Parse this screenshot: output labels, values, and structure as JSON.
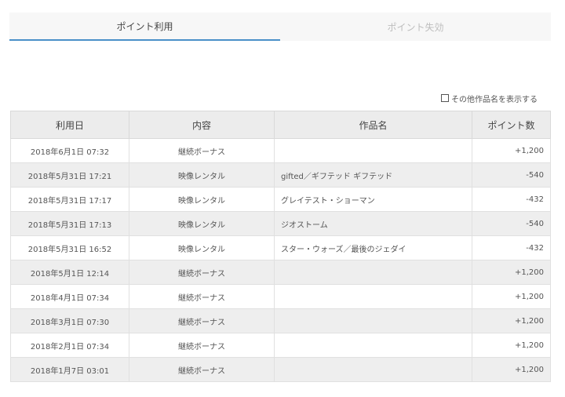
{
  "tabs": [
    {
      "label": "ポイント利用",
      "active": true
    },
    {
      "label": "ポイント失効",
      "active": false
    }
  ],
  "toggle": {
    "label": "その他作品名を表示する",
    "checked": false
  },
  "table": {
    "headers": [
      "利用日",
      "内容",
      "作品名",
      "ポイント数"
    ],
    "rows": [
      {
        "date": "2018年6月1日 07:32",
        "content": "継続ボーナス",
        "title": "",
        "points": "+1,200"
      },
      {
        "date": "2018年5月31日 17:21",
        "content": "映像レンタル",
        "title": "gifted／ギフテッド ギフテッド",
        "points": "-540"
      },
      {
        "date": "2018年5月31日 17:17",
        "content": "映像レンタル",
        "title": "グレイテスト・ショーマン",
        "points": "-432"
      },
      {
        "date": "2018年5月31日 17:13",
        "content": "映像レンタル",
        "title": "ジオストーム",
        "points": "-540"
      },
      {
        "date": "2018年5月31日 16:52",
        "content": "映像レンタル",
        "title": "スター・ウォーズ／最後のジェダイ",
        "points": "-432"
      },
      {
        "date": "2018年5月1日 12:14",
        "content": "継続ボーナス",
        "title": "",
        "points": "+1,200"
      },
      {
        "date": "2018年4月1日 07:34",
        "content": "継続ボーナス",
        "title": "",
        "points": "+1,200"
      },
      {
        "date": "2018年3月1日 07:30",
        "content": "継続ボーナス",
        "title": "",
        "points": "+1,200"
      },
      {
        "date": "2018年2月1日 07:34",
        "content": "継続ボーナス",
        "title": "",
        "points": "+1,200"
      },
      {
        "date": "2018年1月7日 03:01",
        "content": "継続ボーナス",
        "title": "",
        "points": "+1,200"
      }
    ]
  },
  "colors": {
    "accent": "#4a90c8",
    "header_bg": "#ececec",
    "stripe_bg": "#eeeeee"
  }
}
